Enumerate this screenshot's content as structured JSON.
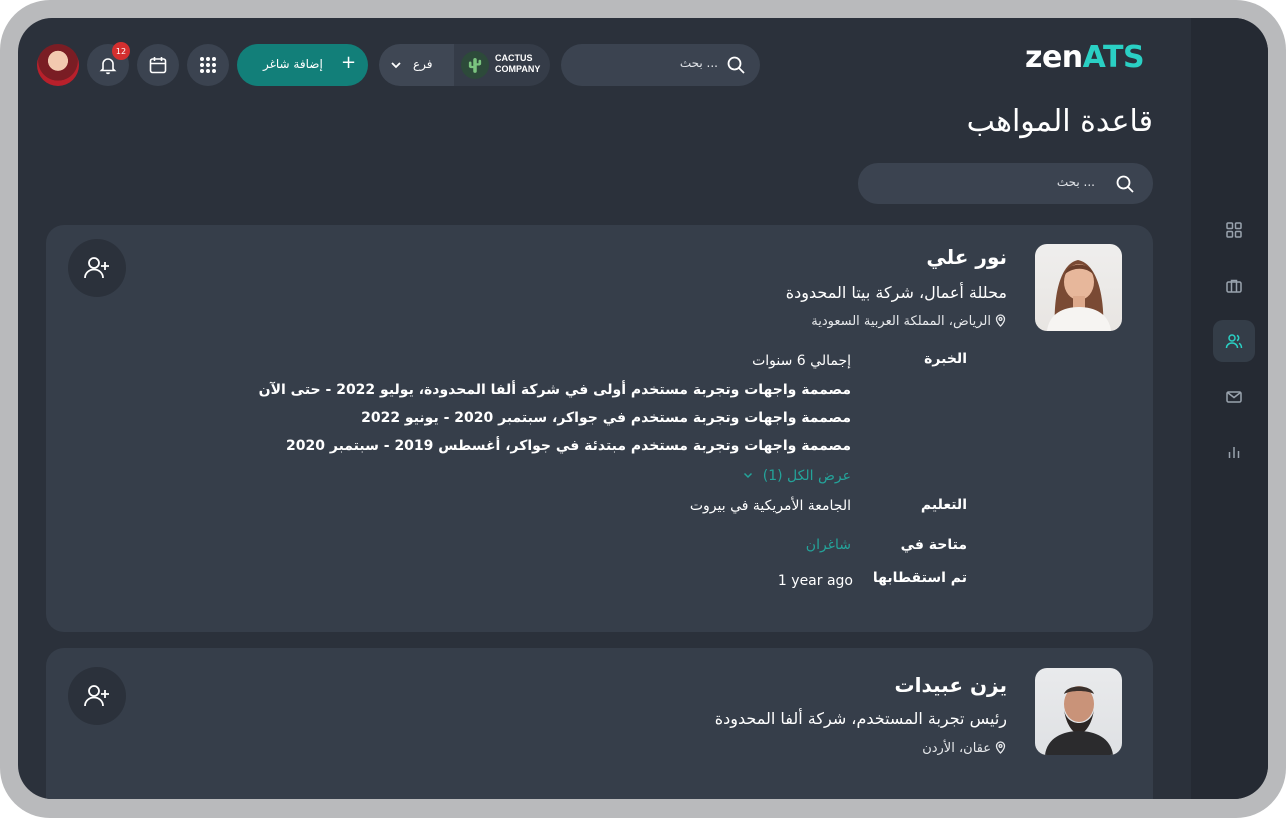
{
  "app": {
    "logo_main": "zen",
    "logo_accent": "ATS"
  },
  "header": {
    "search_placeholder": "بحث ...",
    "branch_label": "فرع",
    "company_line1": "CACTUS",
    "company_line2": "COMPANY",
    "add_job_label": "إضافة شاغر",
    "notifications_count": "12"
  },
  "page": {
    "title": "قاعدة المواهب",
    "search_placeholder": "بحث ..."
  },
  "colors": {
    "accent": "#2ad0c4",
    "primary_button": "#127f79",
    "link": "#24a39a",
    "badge": "#d32f2f"
  },
  "sidebar": {
    "icons": [
      "grid-icon",
      "briefcase-icon",
      "users-icon",
      "mail-icon",
      "bar-chart-icon"
    ],
    "active": "users-icon"
  },
  "candidates": [
    {
      "name": "نور علي",
      "title": "محللة أعمال، شركة بيتا المحدودة",
      "location": "الرياض، المملكة العربية السعودية",
      "experience_label": "الخبرة",
      "experience_total": "إجمالي 6 سنوات",
      "experience_items": [
        "مصممة واجهات وتجربة مستخدم أولى في شركة ألفا المحدودة، يوليو 2022 - حتى الآن",
        "مصممة واجهات وتجربة مستخدم في جواكر، سبتمبر 2020 - يونيو 2022",
        "مصممة واجهات وتجربة مستخدم مبتدئة في جواكر، أغسطس 2019 - سبتمبر 2020"
      ],
      "show_all": "عرض الكل (1)",
      "education_label": "التعليم",
      "education_value": "الجامعة الأمريكية في بيروت",
      "available_label": "متاحة في",
      "available_value": "شاغران",
      "sourced_label": "تم استقطابها",
      "sourced_value": "1 year ago"
    },
    {
      "name": "يزن عبيدات",
      "title": "رئيس تجربة المستخدم، شركة ألفا المحدودة",
      "location": "عقان، الأردن"
    }
  ]
}
